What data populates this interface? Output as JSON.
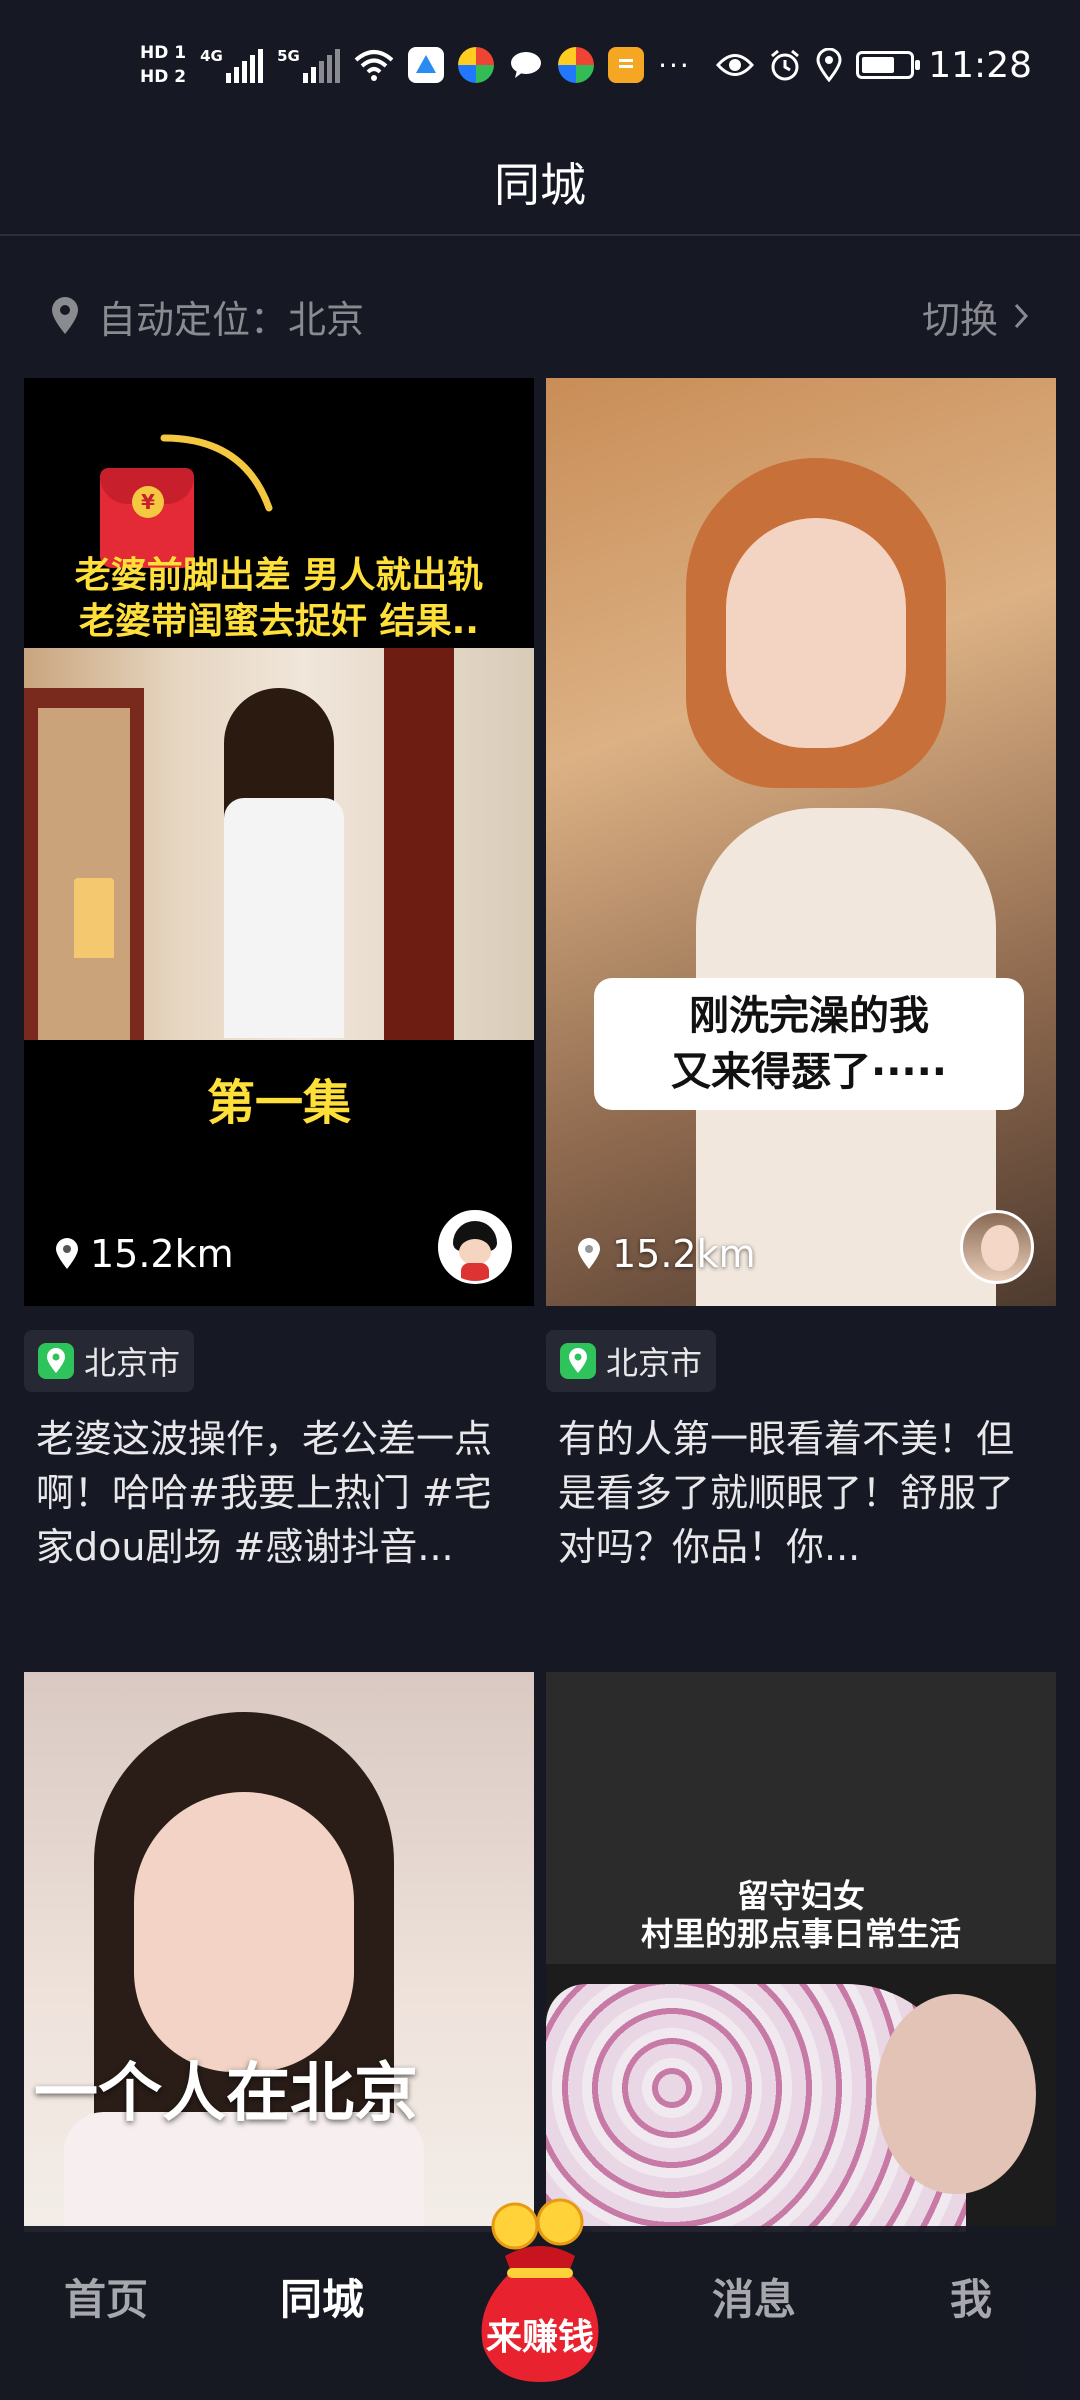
{
  "status_bar": {
    "hd1": "HD 1",
    "hd2": "HD 2",
    "net1": "4G",
    "net2": "5G",
    "more": "···",
    "time": "11:28",
    "battery_level": 0.7
  },
  "header": {
    "title": "同城"
  },
  "location": {
    "label": "自动定位：北京",
    "switch_label": "切换"
  },
  "cards": [
    {
      "distance": "15.2km",
      "city": "北京市",
      "description": "老婆这波操作，老公差一点啊！哈哈#我要上热门 #宅家dou剧场 #感谢抖音...",
      "overlay_line1": "老婆前脚出差 男人就出轨",
      "overlay_line2": "老婆带闺蜜去捉奸 结果..",
      "overlay_episode": "第一集"
    },
    {
      "distance": "15.2km",
      "city": "北京市",
      "description": "有的人第一眼看着不美！但是看多了就顺眼了！舒服了对吗？你品！你...",
      "overlay_line1": "刚洗完澡的我",
      "overlay_line2": "又来得瑟了·····"
    },
    {
      "overlay_text": "一个人在北京"
    },
    {
      "overlay_line1": "留守妇女",
      "overlay_line2": "村里的那点事日常生活"
    }
  ],
  "bottom_nav": {
    "home": "首页",
    "local": "同城",
    "earn": "来赚钱",
    "messages": "消息",
    "me": "我"
  },
  "colors": {
    "background": "#161823",
    "accent_green": "#2fc35c",
    "caption_yellow": "#ffe03a",
    "earn_red": "#e8232f"
  }
}
